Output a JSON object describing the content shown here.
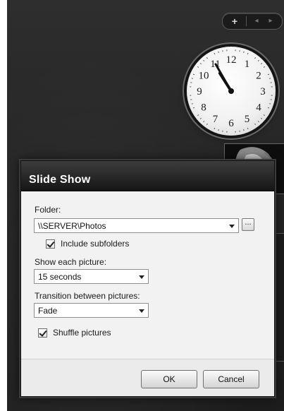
{
  "gadget_bar": {
    "add_label": "+",
    "prev_label": "◂",
    "next_label": "▸"
  },
  "clock": {
    "numerals": [
      "12",
      "1",
      "2",
      "3",
      "4",
      "5",
      "6",
      "7",
      "8",
      "9",
      "10",
      "11"
    ],
    "time": "10:55"
  },
  "dialog": {
    "title": "Slide Show",
    "folder_label": "Folder:",
    "folder_value": "\\\\SERVER\\Photos",
    "browse_label": "...",
    "include_subfolders_label": "Include subfolders",
    "include_subfolders_checked": true,
    "show_each_label": "Show each picture:",
    "show_each_value": "15 seconds",
    "transition_label": "Transition between pictures:",
    "transition_value": "Fade",
    "shuffle_label": "Shuffle pictures",
    "shuffle_checked": true,
    "ok_label": "OK",
    "cancel_label": "Cancel"
  }
}
